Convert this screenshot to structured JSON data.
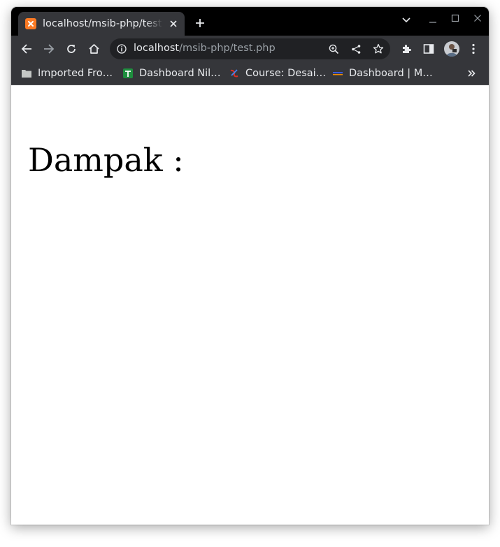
{
  "tab": {
    "title": "localhost/msib-php/test.php",
    "favicon": "xampp-icon"
  },
  "toolbar": {
    "url_host": "localhost",
    "url_path": "/msib-php/test.php"
  },
  "bookmarks": [
    {
      "label": "Imported Fro…",
      "icon": "folder-icon"
    },
    {
      "label": "Dashboard Nil…",
      "icon": "sheets-icon"
    },
    {
      "label": "Course: Desai…",
      "icon": "course-icon"
    },
    {
      "label": "Dashboard | M…",
      "icon": "dashboard-icon"
    }
  ],
  "page": {
    "heading": "Dampak :"
  },
  "colors": {
    "tabstrip": "#000000",
    "toolbar": "#35363a",
    "omnibox": "#202124",
    "favicon": "#fb7a24",
    "text_light": "#e8eaed",
    "text_dim": "#9aa0a6"
  }
}
